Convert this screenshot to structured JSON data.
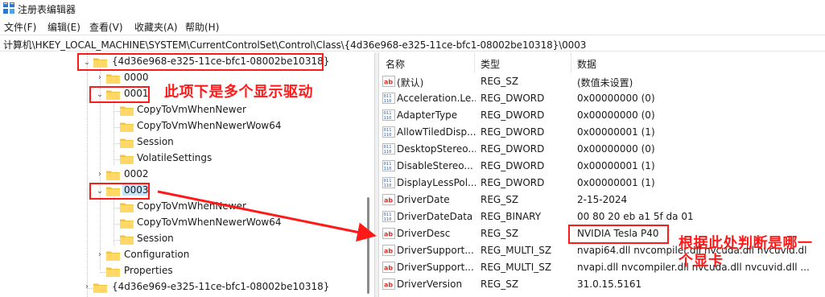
{
  "window": {
    "title": "注册表编辑器",
    "icon": "registry-editor-icon"
  },
  "menu": [
    "文件(F)",
    "编辑(E)",
    "查看(V)",
    "收藏夹(A)",
    "帮助(H)"
  ],
  "address": "计算机\\HKEY_LOCAL_MACHINE\\SYSTEM\\CurrentControlSet\\Control\\Class\\{4d36e968-e325-11ce-bfc1-08002be10318}\\0003",
  "tree": {
    "items": [
      {
        "label": "{4d36e968-e325-11ce-bfc1-08002be10318}",
        "state": "expanded"
      },
      {
        "label": "0000",
        "state": "collapsed"
      },
      {
        "label": "0001",
        "state": "expanded"
      },
      {
        "label": "CopyToVmWhenNewer",
        "state": "leaf"
      },
      {
        "label": "CopyToVmWhenNewerWow64",
        "state": "leaf"
      },
      {
        "label": "Session",
        "state": "leaf"
      },
      {
        "label": "VolatileSettings",
        "state": "leaf"
      },
      {
        "label": "0002",
        "state": "collapsed"
      },
      {
        "label": "0003",
        "state": "expanded-selected"
      },
      {
        "label": "CopyToVmWhenNewer",
        "state": "leaf"
      },
      {
        "label": "CopyToVmWhenNewerWow64",
        "state": "leaf"
      },
      {
        "label": "Session",
        "state": "leaf"
      },
      {
        "label": "Configuration",
        "state": "collapsed"
      },
      {
        "label": "Properties",
        "state": "leaf"
      },
      {
        "label": "{4d36e969-e325-11ce-bfc1-08002be10318}",
        "state": "collapsed"
      }
    ]
  },
  "list": {
    "headers": {
      "name": "名称",
      "type": "类型",
      "data": "数据"
    },
    "rows": [
      {
        "icon": "string-value-icon",
        "name": "(默认)",
        "type": "REG_SZ",
        "data": "(数值未设置)"
      },
      {
        "icon": "binary-value-icon",
        "name": "Acceleration.Le...",
        "type": "REG_DWORD",
        "data": "0x00000000 (0)"
      },
      {
        "icon": "binary-value-icon",
        "name": "AdapterType",
        "type": "REG_DWORD",
        "data": "0x00000000 (0)"
      },
      {
        "icon": "binary-value-icon",
        "name": "AllowTiledDisp...",
        "type": "REG_DWORD",
        "data": "0x00000001 (1)"
      },
      {
        "icon": "binary-value-icon",
        "name": "DesktopStereo...",
        "type": "REG_DWORD",
        "data": "0x00000000 (0)"
      },
      {
        "icon": "binary-value-icon",
        "name": "DisableStereo...",
        "type": "REG_DWORD",
        "data": "0x00000001 (1)"
      },
      {
        "icon": "binary-value-icon",
        "name": "DisplayLessPol...",
        "type": "REG_DWORD",
        "data": "0x00000001 (1)"
      },
      {
        "icon": "string-value-icon",
        "name": "DriverDate",
        "type": "REG_SZ",
        "data": "2-15-2024"
      },
      {
        "icon": "binary-value-icon",
        "name": "DriverDateData",
        "type": "REG_BINARY",
        "data": "00 80 20 eb a1 5f da 01"
      },
      {
        "icon": "string-value-icon",
        "name": "DriverDesc",
        "type": "REG_SZ",
        "data": "NVIDIA Tesla P40"
      },
      {
        "icon": "string-value-icon",
        "name": "DriverSupport...",
        "type": "REG_MULTI_SZ",
        "data": "nvapi64.dll nvcompiler.dll nvcuda.dll nvcuvid.dl"
      },
      {
        "icon": "string-value-icon",
        "name": "DriverSupport...",
        "type": "REG_MULTI_SZ",
        "data": "nvapi.dll nvcompiler.dll nvcuda.dll nvcuvid.dll ..."
      },
      {
        "icon": "string-value-icon",
        "name": "DriverVersion",
        "type": "REG_SZ",
        "data": "31.0.15.5161"
      }
    ]
  },
  "annotations": {
    "note_multiple_drivers": "此项下是多个显示驱动",
    "note_judge_gpu": "根据此处判断是哪一个显卡",
    "color": "#ff1a1a"
  }
}
